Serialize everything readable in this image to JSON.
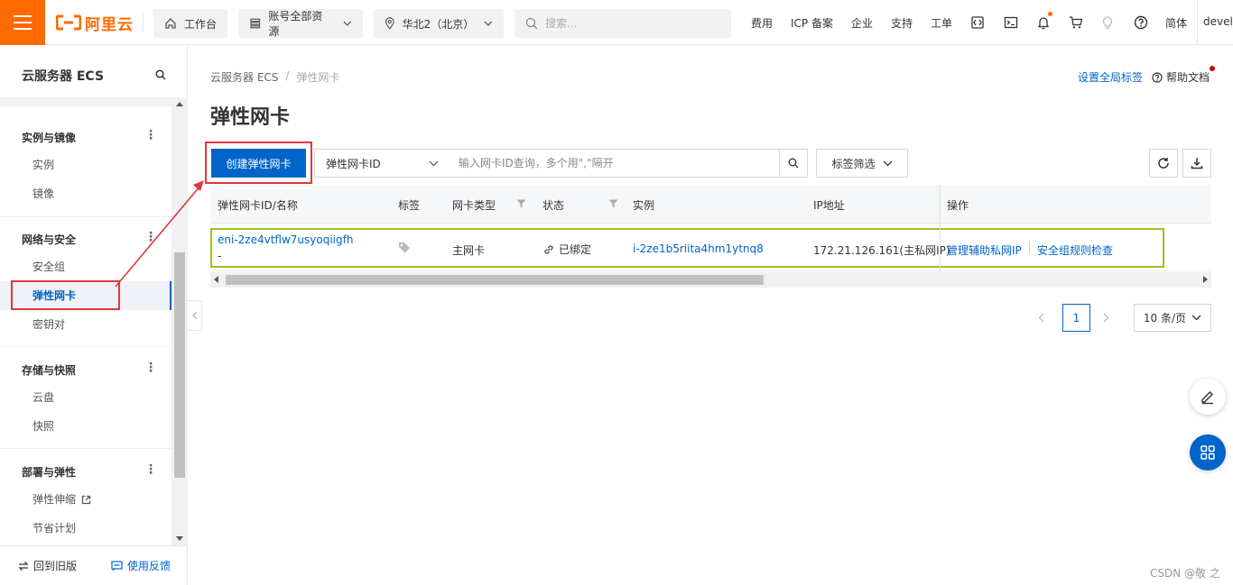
{
  "topbar": {
    "logo_text": "阿里云",
    "workbench": "工作台",
    "resources": "账号全部资源",
    "region": "华北2（北京）",
    "search_placeholder": "搜索...",
    "links": {
      "fees": "费用",
      "icp": "ICP 备案",
      "enterprise": "企业",
      "support": "支持",
      "ticket": "工单",
      "lang": "简体"
    },
    "user": "devel"
  },
  "sidebar": {
    "title": "云服务器 ECS",
    "groups": [
      {
        "header": "实例与镜像",
        "items": [
          "实例",
          "镜像"
        ]
      },
      {
        "header": "网络与安全",
        "items": [
          "安全组",
          "弹性网卡",
          "密钥对"
        ]
      },
      {
        "header": "存储与快照",
        "items": [
          "云盘",
          "快照"
        ]
      },
      {
        "header": "部署与弹性",
        "items": [
          "弹性伸缩",
          "节省计划"
        ]
      }
    ],
    "footer": {
      "back": "回到旧版",
      "feedback": "使用反馈"
    }
  },
  "main": {
    "breadcrumb": [
      "云服务器 ECS",
      "弹性网卡"
    ],
    "breadcrumb_sep": "/",
    "set_tags": "设置全局标签",
    "help_docs": "帮助文档",
    "title": "弹性网卡",
    "toolbar": {
      "create": "创建弹性网卡",
      "filter_select": "弹性网卡ID",
      "filter_placeholder": "输入网卡ID查询，多个用\",\"隔开",
      "tag_filter": "标签筛选"
    },
    "table": {
      "columns": [
        "弹性网卡ID/名称",
        "标签",
        "网卡类型",
        "状态",
        "实例",
        "IP地址",
        "操作"
      ],
      "rows": [
        {
          "id": "eni-2ze4vtflw7usyoqiigfh",
          "name": "-",
          "type": "主网卡",
          "status": "已绑定",
          "instance": "i-2ze1b5riita4hm1ytnq8",
          "ip": "172.21.126.161(主私网IP)",
          "actions": [
            "管理辅助私网IP",
            "安全组规则检查"
          ]
        }
      ]
    },
    "pagination": {
      "current": "1",
      "page_size": "10 条/页"
    }
  },
  "watermark": "CSDN @敬 之",
  "colors": {
    "brand_orange": "#ff6a00",
    "primary_blue": "#0064c8",
    "annotation_red": "#e0383e",
    "annotation_green": "#9bc320"
  }
}
